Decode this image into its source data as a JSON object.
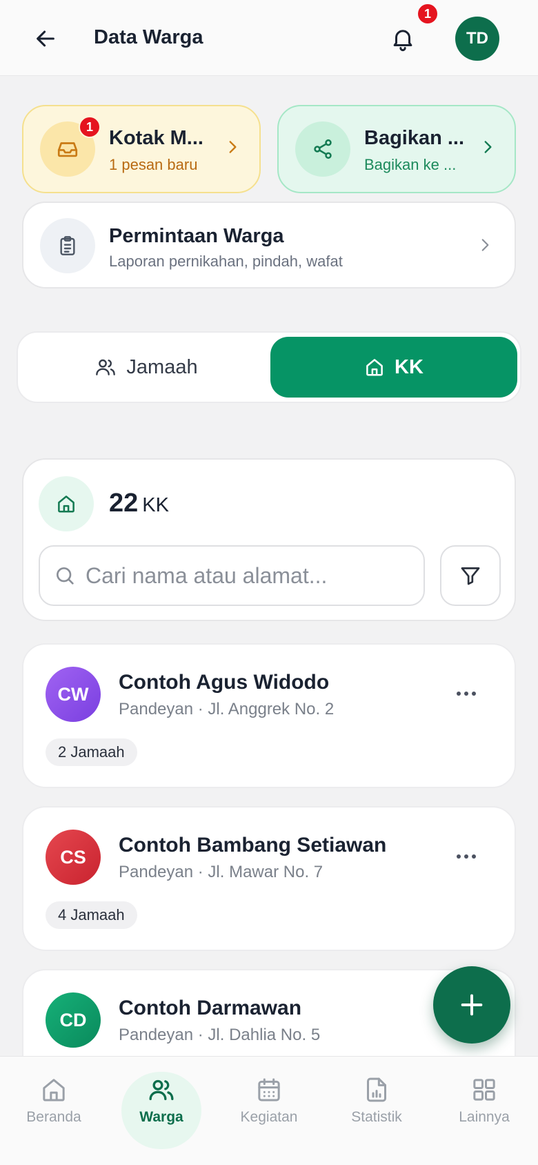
{
  "header": {
    "title": "Data Warga",
    "notification_count": "1",
    "avatar_initials": "TD"
  },
  "quick_cards": {
    "inbox": {
      "title": "Kotak M...",
      "subtitle": "1 pesan baru",
      "badge": "1"
    },
    "share": {
      "title": "Bagikan ...",
      "subtitle": "Bagikan ke ..."
    }
  },
  "request": {
    "title": "Permintaan Warga",
    "subtitle": "Laporan pernikahan, pindah, wafat"
  },
  "segment": {
    "tab1_label": "Jamaah",
    "tab2_label": "KK",
    "selected": "KK"
  },
  "summary": {
    "count": "22",
    "unit": "KK",
    "search_placeholder": "Cari nama atau alamat..."
  },
  "kk_list": [
    {
      "initials": "CW",
      "name": "Contoh Agus Widodo",
      "address": "Pandeyan · Jl. Anggrek No. 2",
      "members": "2 Jamaah",
      "color": "#8b4fe8"
    },
    {
      "initials": "CS",
      "name": "Contoh Bambang Setiawan",
      "address": "Pandeyan · Jl. Mawar No. 7",
      "members": "4 Jamaah",
      "color": "#d9323e"
    },
    {
      "initials": "CD",
      "name": "Contoh Darmawan",
      "address": "Pandeyan · Jl. Dahlia No. 5",
      "members": "",
      "color": "#0e9a66"
    }
  ],
  "bottom_nav": {
    "items": [
      {
        "label": "Beranda",
        "icon": "home-icon"
      },
      {
        "label": "Warga",
        "icon": "users-icon"
      },
      {
        "label": "Kegiatan",
        "icon": "calendar-icon"
      },
      {
        "label": "Statistik",
        "icon": "chart-file-icon"
      },
      {
        "label": "Lainnya",
        "icon": "grid-icon"
      }
    ],
    "active": "Warga"
  },
  "colors": {
    "primary": "#0d6e4c",
    "primary_bright": "#069465",
    "alert": "#e5141f"
  }
}
